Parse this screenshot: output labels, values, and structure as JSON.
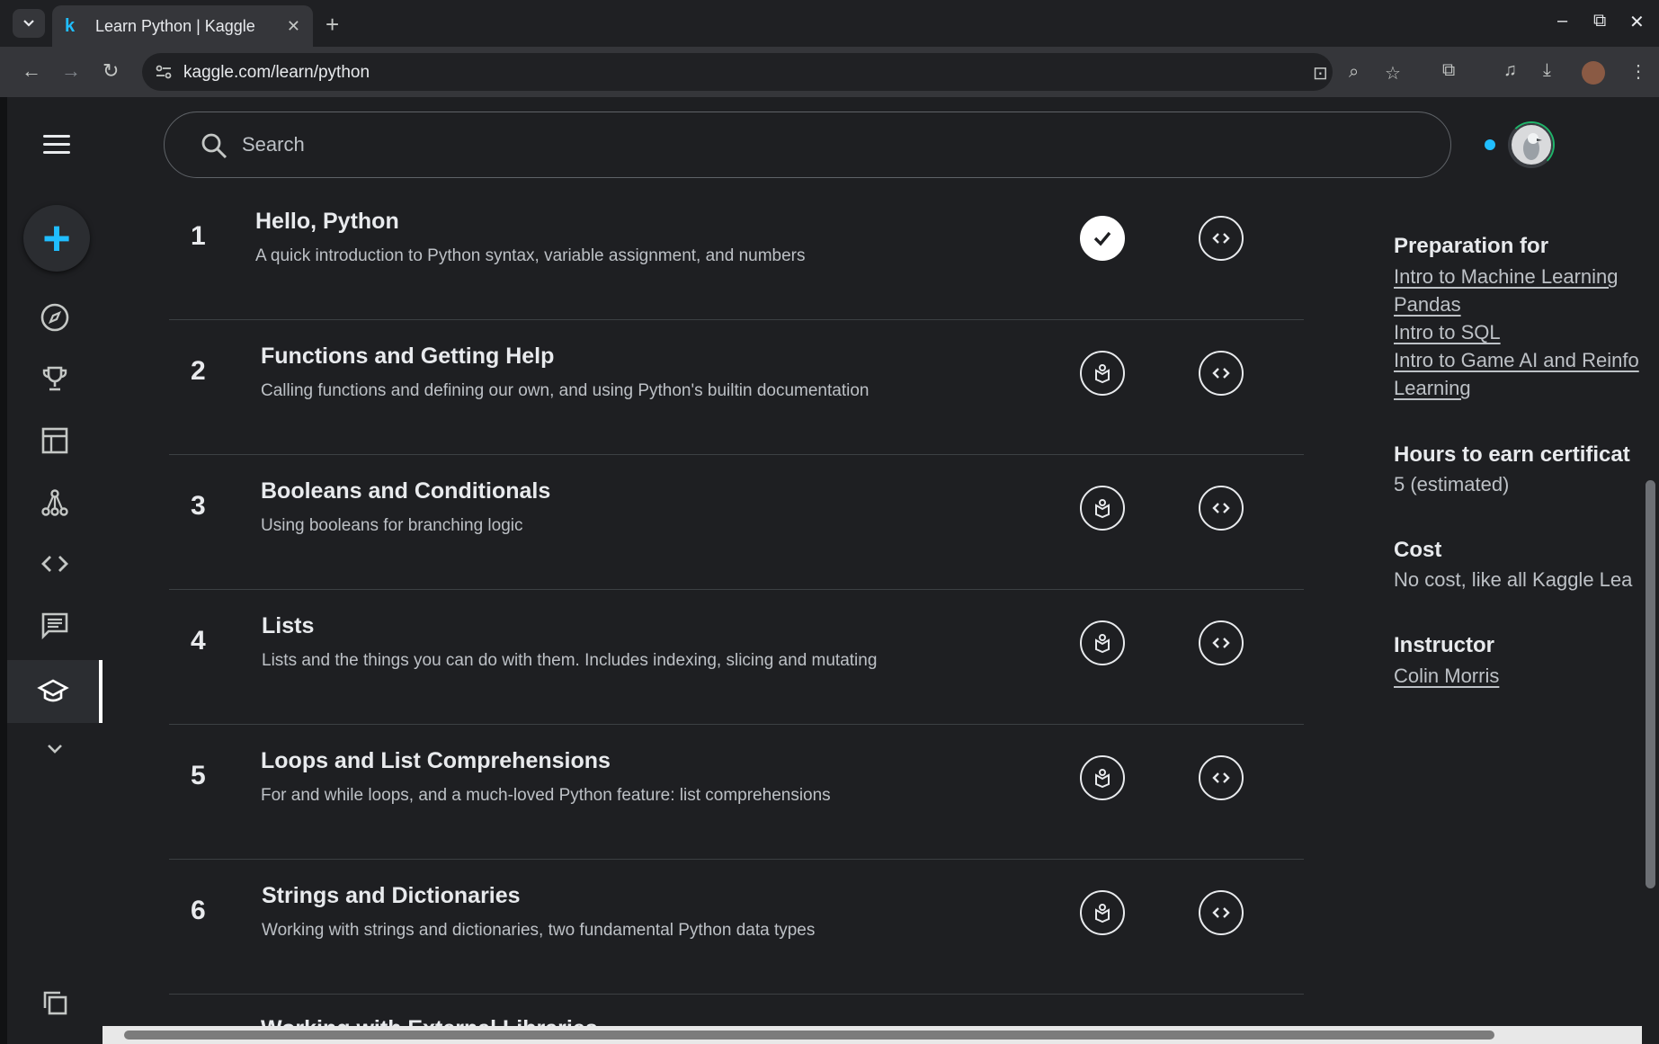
{
  "browser": {
    "tab_title": "Learn Python | Kaggle",
    "tab_favicon": "k",
    "url": "kaggle.com/learn/python",
    "new_tab": "+",
    "minimize": "–",
    "restore": "⧉",
    "close": "✕"
  },
  "search": {
    "placeholder": "Search"
  },
  "lessons": [
    {
      "num": "1",
      "title": "Hello, Python",
      "desc": "A quick introduction to Python syntax, variable assignment, and numbers",
      "completed": true
    },
    {
      "num": "2",
      "title": "Functions and Getting Help",
      "desc": "Calling functions and defining our own, and using Python's builtin documentation",
      "completed": false
    },
    {
      "num": "3",
      "title": "Booleans and Conditionals",
      "desc": "Using booleans for branching logic",
      "completed": false
    },
    {
      "num": "4",
      "title": "Lists",
      "desc": "Lists and the things you can do with them. Includes indexing, slicing and mutating",
      "completed": false
    },
    {
      "num": "5",
      "title": "Loops and List Comprehensions",
      "desc": "For and while loops, and a much-loved Python feature: list comprehensions",
      "completed": false
    },
    {
      "num": "6",
      "title": "Strings and Dictionaries",
      "desc": "Working with strings and dictionaries, two fundamental Python data types",
      "completed": false
    },
    {
      "num": "",
      "title": "Working with External Libraries",
      "desc": "",
      "completed": false
    }
  ],
  "sidebar_info": {
    "prep_heading": "Preparation for",
    "prep_links": [
      "Intro to Machine Learning",
      "Pandas",
      "Intro to SQL",
      "Intro to Game AI and Reinfo",
      "Learning"
    ],
    "hours_heading": "Hours to earn certificat",
    "hours_value": "5 (estimated)",
    "cost_heading": "Cost",
    "cost_value": "No cost, like all Kaggle Lea",
    "instructor_heading": "Instructor",
    "instructor_name": "Colin Morris"
  },
  "colors": {
    "accent": "#20beff",
    "background": "#1e1f22",
    "divider": "#3c4043"
  },
  "icons": {
    "nav": [
      "hamburger-menu-icon",
      "create-plus-icon",
      "compass-icon",
      "trophy-icon",
      "table-icon",
      "models-network-icon",
      "code-icon",
      "discussion-icon",
      "learn-cap-icon",
      "chevron-down-icon",
      "copy-icon"
    ],
    "lesson_actions": [
      "check-icon",
      "tutorial-book-icon",
      "exercise-code-icon"
    ]
  }
}
